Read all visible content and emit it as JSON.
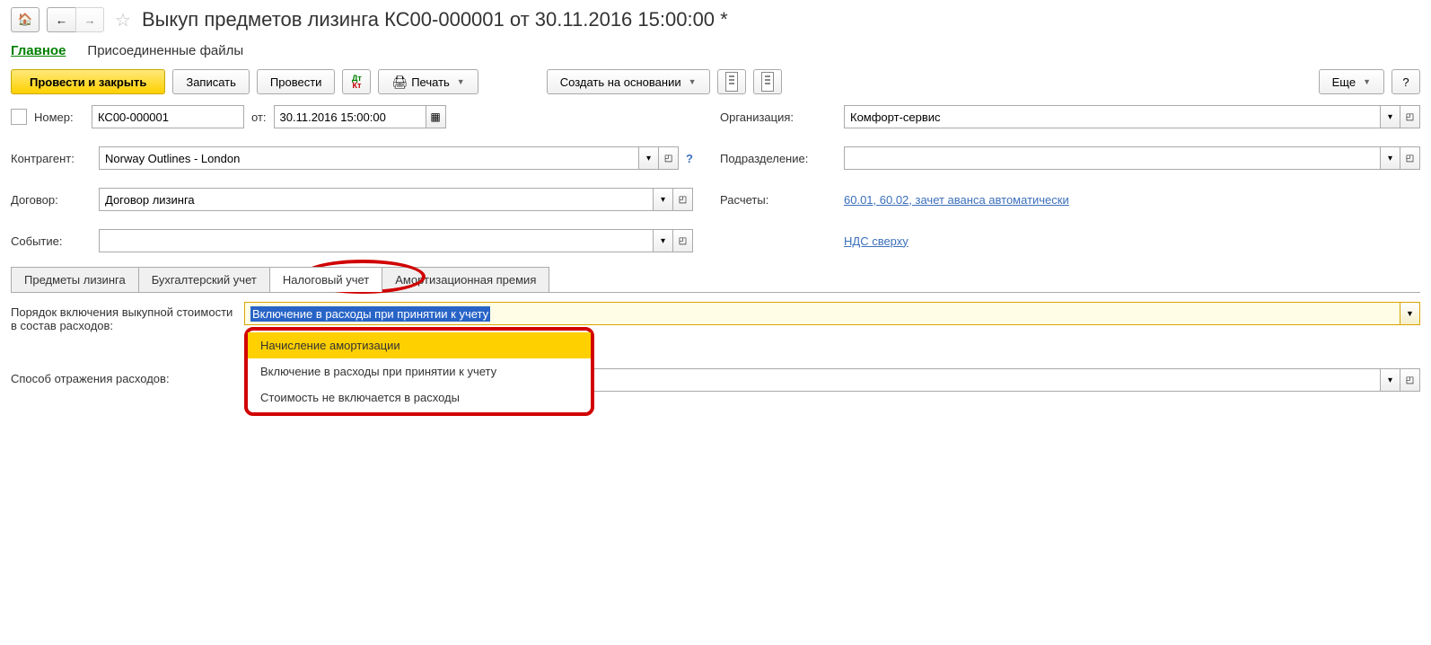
{
  "page_title": "Выкуп предметов лизинга КС00-000001 от 30.11.2016 15:00:00 *",
  "sections": {
    "main": "Главное",
    "files": "Присоединенные файлы"
  },
  "toolbar": {
    "post_close": "Провести и закрыть",
    "save": "Записать",
    "post": "Провести",
    "print": "Печать",
    "create_on_basis": "Создать на основании",
    "more": "Еще",
    "help": "?"
  },
  "form": {
    "number_label": "Номер:",
    "number_value": "КС00-000001",
    "from_label": "от:",
    "date_value": "30.11.2016 15:00:00",
    "org_label": "Организация:",
    "org_value": "Комфорт-сервис",
    "counterparty_label": "Контрагент:",
    "counterparty_value": "Norway Outlines - London",
    "division_label": "Подразделение:",
    "contract_label": "Договор:",
    "contract_value": "Договор лизинга",
    "calculations_label": "Расчеты:",
    "calculations_link": "60.01, 60.02, зачет аванса автоматически",
    "event_label": "Событие:",
    "vat_link": "НДС сверху"
  },
  "tabs": {
    "t1": "Предметы лизинга",
    "t2": "Бухгалтерский учет",
    "t3": "Налоговый учет",
    "t4": "Амортизационная премия"
  },
  "tax_tab": {
    "order_label": "Порядок включения выкупной стоимости в состав расходов:",
    "order_value": "Включение в расходы при принятии к учету",
    "method_label": "Способ отражения расходов:",
    "options": {
      "o1": "Начисление амортизации",
      "o2": "Включение в расходы при принятии к учету",
      "o3": "Стоимость не включается в расходы"
    }
  }
}
